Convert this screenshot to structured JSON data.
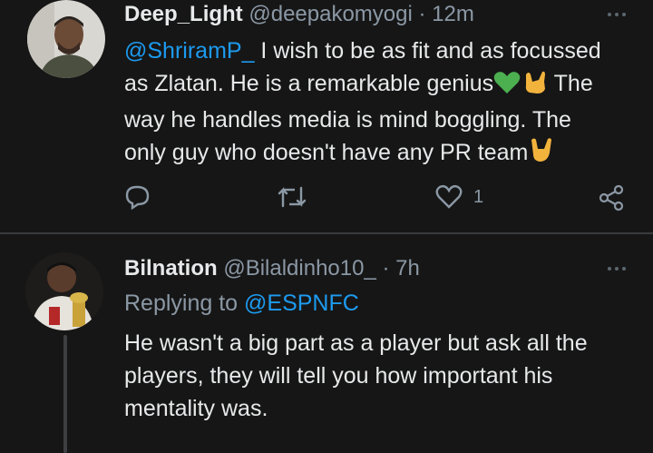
{
  "tweets": [
    {
      "name": "Deep_Light",
      "handle": "@deepakomyogi",
      "separator": "·",
      "time": "12m",
      "mention": "@ShriramP_",
      "line1_rest": " I wish to be as fit and as focussed",
      "line2": "as Zlatan. He is a remarkable genius",
      "line2_end": " The",
      "line3": "way he handles media is mind boggling. The",
      "line4": "only guy who doesn't have any PR team",
      "likes": "1"
    },
    {
      "name": "Bilnation",
      "handle": "@Bilaldinho10_",
      "separator": "·",
      "time": "7h",
      "replying_label": "Replying to ",
      "replying_to": "@ESPNFC",
      "line1": "He wasn't a big part as a player but ask all the",
      "line2": "players, they will tell you how important his",
      "line3": "mentality was."
    }
  ],
  "colors": {
    "background": "#161616",
    "link": "#1d9bf0",
    "secondary": "#8b98a5",
    "text": "#e7e9ea",
    "heart_green": "#4caf50"
  }
}
